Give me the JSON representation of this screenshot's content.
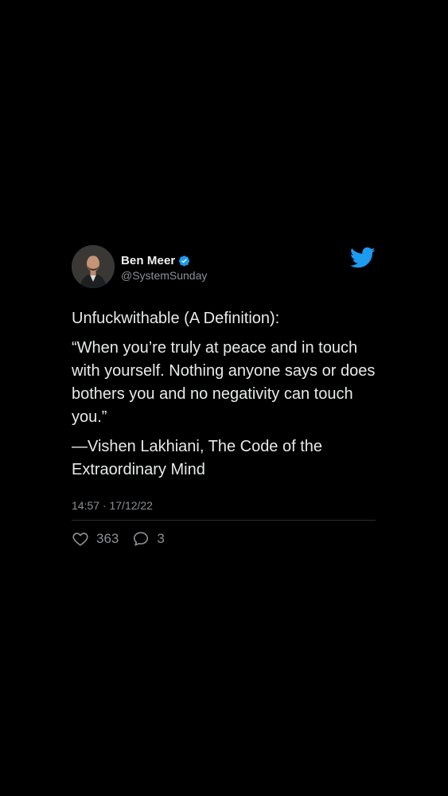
{
  "tweet": {
    "author": {
      "name": "Ben Meer",
      "handle": "@SystemSunday",
      "verified": true,
      "avatar_icon": "avatar-photo"
    },
    "brand_icon": "twitter-bird-icon",
    "title_line": "Unfuckwithable (A Definition):",
    "quote": "“When you’re truly at peace and in touch with yourself. Nothing anyone says or does bothers you and no negativity can touch you.”",
    "attribution": "—Vishen Lakhiani, The Code of the Extraordinary Mind",
    "timestamp": "14:57 · 17/12/22",
    "likes": "363",
    "replies": "3"
  },
  "colors": {
    "background": "#000000",
    "text": "#e7e9ea",
    "muted": "#8b8f93",
    "twitter_blue": "#1d9bf0",
    "divider": "#2b2e31"
  }
}
